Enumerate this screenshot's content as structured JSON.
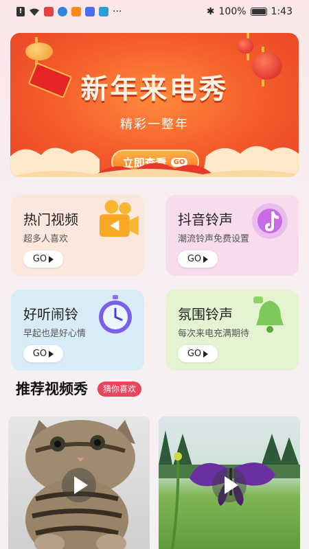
{
  "status_bar": {
    "battery": "100%",
    "time": "1:43",
    "more": "···"
  },
  "banner": {
    "title": "新年来电秀",
    "subtitle": "精彩一整年",
    "button_label": "立即查看",
    "button_tag": "GO"
  },
  "cards": [
    {
      "title": "热门视频",
      "desc": "超多人喜欢",
      "go": "GO",
      "icon": "video-camera-icon",
      "bg": "#fbe7dc"
    },
    {
      "title": "抖音铃声",
      "desc": "潮流铃声免费设置",
      "go": "GO",
      "icon": "tiktok-note-icon",
      "bg": "#f6dcec"
    },
    {
      "title": "好听闹铃",
      "desc": "早起也是好心情",
      "go": "GO",
      "icon": "alarm-clock-icon",
      "bg": "#d8ecf7"
    },
    {
      "title": "氛围铃声",
      "desc": "每次来电充满期待",
      "go": "GO",
      "icon": "bell-icon",
      "bg": "#e4f3d1"
    }
  ],
  "section": {
    "title": "推荐视频秀",
    "badge": "猜你喜欢"
  },
  "videos": [
    {
      "subject": "kitten"
    },
    {
      "subject": "butterfly"
    }
  ],
  "colors": {
    "accent": "#e8455a",
    "banner_orange": "#f45a2a"
  }
}
